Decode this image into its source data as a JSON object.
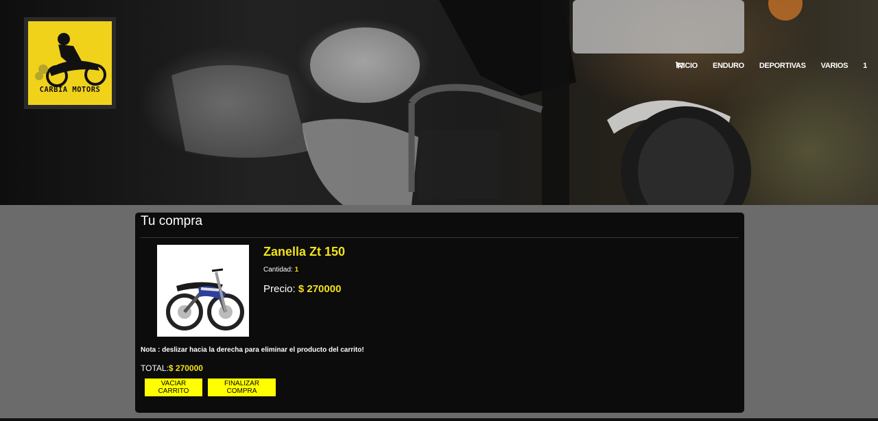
{
  "brand": {
    "logo_text": "CARBIA MOTORS"
  },
  "nav": {
    "items": [
      {
        "label": "INICIO"
      },
      {
        "label": "ENDURO"
      },
      {
        "label": "DEPORTIVAS"
      },
      {
        "label": "VARIOS"
      }
    ],
    "cart_count": "1"
  },
  "cart": {
    "title": "Tu compra",
    "product": {
      "name": "Zanella Zt 150",
      "quantity_label": "Cantidad:",
      "quantity": "1",
      "price_label": "Precio:",
      "price": "$ 270000"
    },
    "note": "Nota : deslizar hacia la derecha para eliminar el producto del carrito!",
    "total_label": "TOTAL:",
    "total": "$ 270000",
    "buttons": {
      "empty": "VACIAR CARRITO",
      "checkout": "FINALIZAR COMPRA"
    }
  },
  "colors": {
    "accent": "#f2e21a",
    "button": "#ffff00",
    "card_bg": "#0c0c0c",
    "page_bg": "#6b6b6b"
  }
}
